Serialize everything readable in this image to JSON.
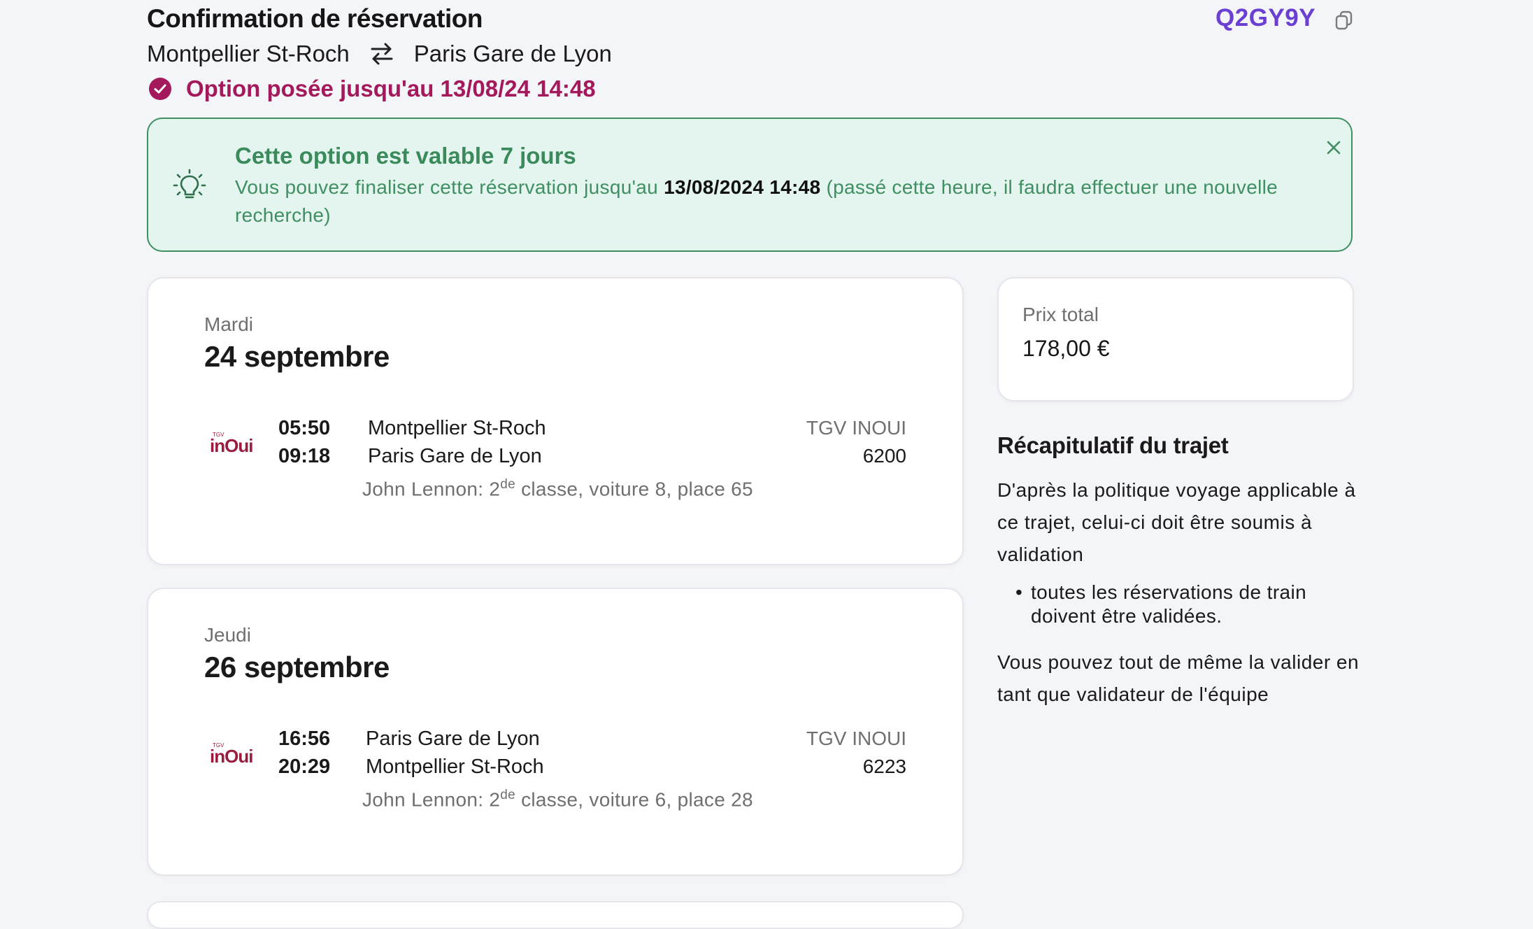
{
  "header": {
    "title": "Confirmation de réservation",
    "pnr": "Q2GY9Y",
    "route": {
      "origin": "Montpellier St-Roch",
      "destination": "Paris Gare de Lyon"
    },
    "option_status": "Option posée jusqu'au 13/08/24 14:48",
    "icons": {
      "copy": "copy-icon",
      "swap": "swap-arrows-icon",
      "status": "check-circle-icon"
    },
    "colors": {
      "pnr": "#6a3fd1",
      "status": "#a3195b"
    }
  },
  "banner": {
    "title": "Cette option est valable 7 jours",
    "text_before": "Vous pouvez finaliser cette réservation jusqu'au ",
    "deadline": "13/08/2024 14:48",
    "text_after": " (passé cette heure, il faudra effectuer une nouvelle recherche)",
    "icons": {
      "bulb": "lightbulb-icon",
      "close": "close-icon"
    },
    "colors": {
      "background": "#e3f5ee",
      "accent": "#3f8f62"
    }
  },
  "trips": [
    {
      "day": "Mardi",
      "date": "24 septembre",
      "logo_text": "inOui",
      "logo_small": "TGV",
      "departure_time": "05:50",
      "arrival_time": "09:18",
      "origin": "Montpellier St-Roch",
      "destination": "Paris Gare de Lyon",
      "carrier": "TGV INOUI",
      "train_number": "6200",
      "seat_prefix": "John Lennon: 2",
      "seat_sup": "de",
      "seat_suffix": " classe, voiture 8, place 65"
    },
    {
      "day": "Jeudi",
      "date": "26 septembre",
      "logo_text": "inOui",
      "logo_small": "TGV",
      "departure_time": "16:56",
      "arrival_time": "20:29",
      "origin": "Paris Gare de Lyon",
      "destination": "Montpellier St-Roch",
      "carrier": "TGV INOUI",
      "train_number": "6223",
      "seat_prefix": "John Lennon: 2",
      "seat_sup": "de",
      "seat_suffix": " classe, voiture 6, place 28"
    }
  ],
  "price": {
    "label": "Prix total",
    "value": "178,00 €"
  },
  "recap": {
    "title": "Récapitulatif du trajet",
    "text": "D'après la politique voyage applicable à ce trajet, celui-ci doit être soumis à validation",
    "bullets": [
      "toutes les réservations de train doivent être validées."
    ],
    "text2": "Vous pouvez tout de même la valider en tant que validateur de l'équipe"
  }
}
